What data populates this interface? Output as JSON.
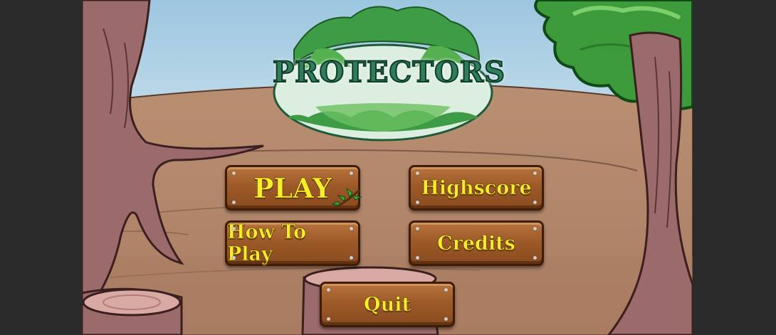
{
  "game": {
    "title_logo": "PROTECTORS"
  },
  "menu": {
    "play": "PLAY",
    "highscore": "Highscore",
    "how_to_play": "How To Play",
    "credits": "Credits",
    "quit": "Quit"
  },
  "colors": {
    "letterbox": "#2b2b2b",
    "sky": "#a9cfe4",
    "ground": "#b48a6e",
    "wood": "#9d5a28",
    "label": "#f7ee2b",
    "foliage": "#3c9a3a"
  },
  "icons": [
    "leaf-sprig-icon"
  ]
}
